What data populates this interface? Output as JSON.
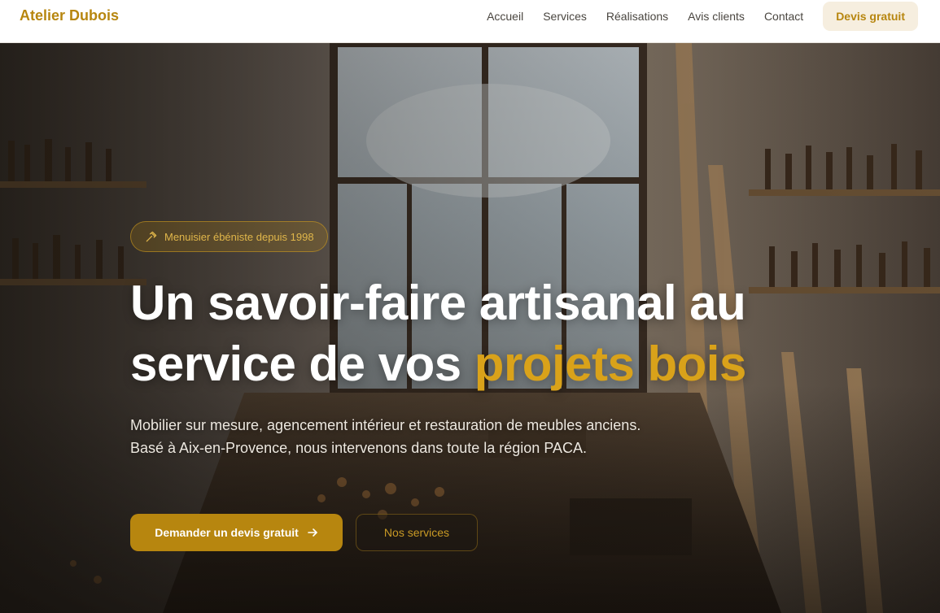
{
  "header": {
    "brand": "Atelier Dubois",
    "nav": [
      "Accueil",
      "Services",
      "Réalisations",
      "Avis clients",
      "Contact"
    ],
    "cta": "Devis gratuit"
  },
  "hero": {
    "badge": "Menuisier ébéniste depuis 1998",
    "title_line1": "Un savoir-faire artisanal au",
    "title_line2_start": "service de vos ",
    "title_accent": "projets bois",
    "lead": "Mobilier sur mesure, agencement intérieur et restauration de meubles anciens. Basé à Aix-en-Provence, nous intervenons dans toute la région PACA.",
    "primary_button": "Demander un devis gratuit",
    "secondary_button": "Nos services"
  },
  "colors": {
    "accent": "#b7860f",
    "accent_light": "#d9a21a",
    "cta_background": "#f6eedf"
  },
  "icons": {
    "badge_icon": "hammer-icon",
    "button_icon": "arrow-right-icon"
  }
}
